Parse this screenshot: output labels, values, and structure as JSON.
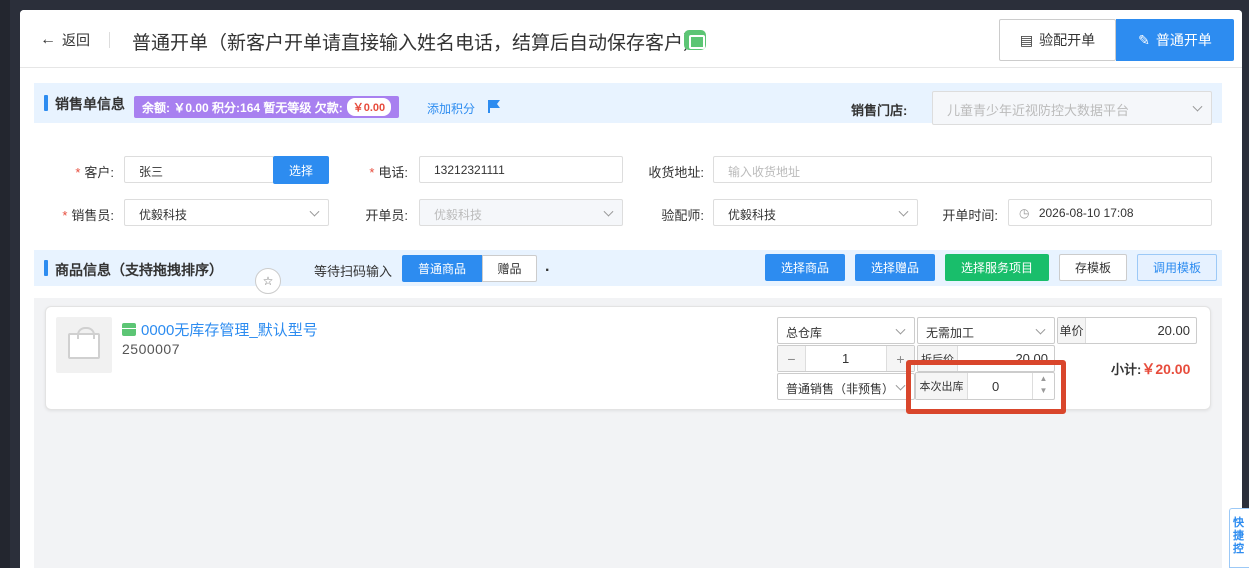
{
  "header": {
    "back_label": "返回",
    "title": "普通开单（新客户开单请直接输入姓名电话，结算后自动保存客户）",
    "btn_peijing": "验配开单",
    "btn_putong": "普通开单"
  },
  "sales": {
    "section_title": "销售单信息",
    "balance_text": "余额: ￥0.00  积分:164  暂无等级  欠款:",
    "debt_value": "￥0.00",
    "add_points": "添加积分",
    "store_label": "销售门店:",
    "store_value": "儿童青少年近视防控大数据平台"
  },
  "form": {
    "customer_label": "客户:",
    "customer_value": "张三",
    "select_btn": "选择",
    "phone_label": "电话:",
    "phone_value": "13212321111",
    "address_label": "收货地址:",
    "address_placeholder": "输入收货地址",
    "seller_label": "销售员:",
    "seller_value": "优毅科技",
    "opener_label": "开单员:",
    "opener_value": "优毅科技",
    "optician_label": "验配师:",
    "optician_value": "优毅科技",
    "time_label": "开单时间:",
    "time_value": "2026-08-10 17:08"
  },
  "goods": {
    "section_title": "商品信息（支持拖拽排序）",
    "scan_label": "等待扫码输入",
    "tab_normal": "普通商品",
    "tab_gift": "赠品",
    "dot": ".",
    "btn_select_goods": "选择商品",
    "btn_select_gift": "选择赠品",
    "btn_select_service": "选择服务项目",
    "btn_save_tpl": "存模板",
    "btn_use_tpl": "调用模板"
  },
  "item": {
    "name": "0000无库存管理_默认型号",
    "code": "2500007",
    "warehouse": "总仓库",
    "process": "无需加工",
    "price_label": "单价",
    "price_value": "20.00",
    "qty": "1",
    "minus": "−",
    "plus": "+",
    "discount_label": "折后价",
    "discount_value": "20.00",
    "subtotal_label": "小计:",
    "subtotal_value": "￥20.00",
    "sale_type": "普通销售（非预售）",
    "out_label": "本次出库",
    "out_value": "0"
  },
  "side": {
    "text": "快捷控"
  }
}
